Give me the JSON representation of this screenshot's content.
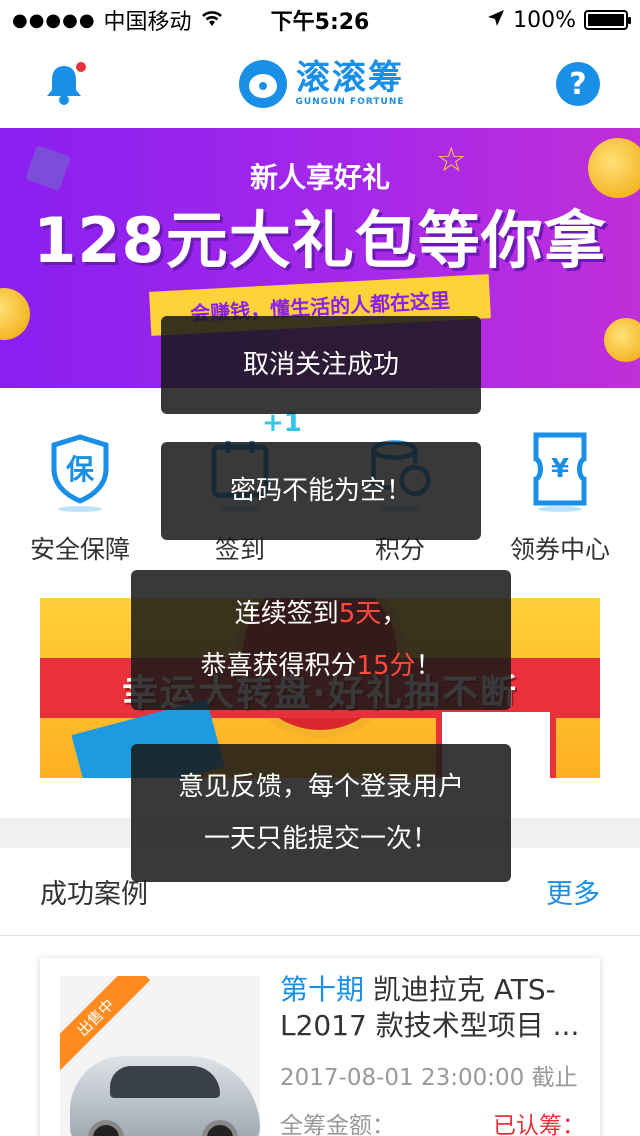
{
  "status_bar": {
    "carrier": "中国移动",
    "time": "下午5:26",
    "battery": "100%"
  },
  "header": {
    "logo_cn": "滚滚筹",
    "logo_en": "GUNGUN FORTUNE",
    "help_label": "?"
  },
  "banner": {
    "subtitle": "新人享好礼",
    "headline": "128元大礼包等你拿",
    "tagline": "会赚钱，懂生活的人都在这里"
  },
  "quick_nav": [
    {
      "label": "安全保障",
      "icon": "shield-icon"
    },
    {
      "label": "签到",
      "icon": "calendar-icon"
    },
    {
      "label": "积分",
      "icon": "coins-icon"
    },
    {
      "label": "领券中心",
      "icon": "coupon-icon"
    }
  ],
  "checkin_bonus": "+1",
  "lucky_banner": {
    "title": "幸运大转盘·好礼抽不断"
  },
  "section": {
    "title": "成功案例",
    "more": "更多"
  },
  "case": {
    "tag": "出售中",
    "period": "第十期",
    "title": "凯迪拉克 ATS-L2017 款技术型项目 ...",
    "date": "2017-08-01  23:00:00 截止",
    "total_label": "全筹金额：",
    "raised_label": "已认筹："
  },
  "toasts": {
    "unfollow": "取消关注成功",
    "password_empty": "密码不能为空！",
    "checkin_line1_pre": "连续签到",
    "checkin_days": "5天",
    "checkin_line1_post": "，",
    "checkin_line2_pre": "恭喜获得积分",
    "checkin_points": "15分",
    "checkin_line2_post": "！",
    "feedback_line1": "意见反馈，每个登录用户",
    "feedback_line2": "一天只能提交一次！"
  },
  "colors": {
    "brand_blue": "#1a8fe8",
    "highlight_red": "#ff4a3a",
    "banner_purple": "#8a1ff0"
  }
}
